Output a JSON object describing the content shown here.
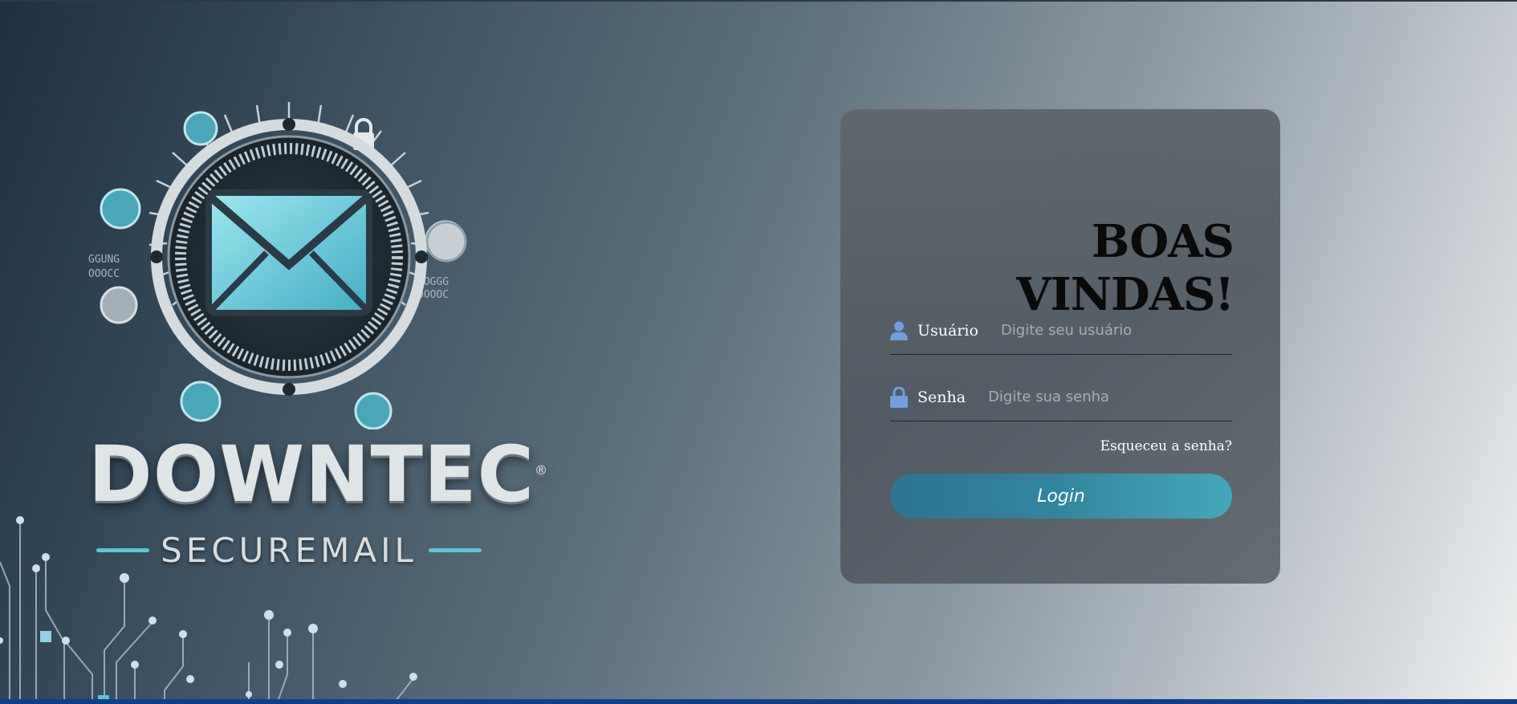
{
  "brand": {
    "name": "DOWNTEC",
    "trademark": "®",
    "subtitle": "SECUREMAIL"
  },
  "login": {
    "title": "BOAS VINDAS!",
    "username": {
      "label": "Usuário",
      "placeholder": "Digite seu usuário",
      "icon": "user-icon"
    },
    "password": {
      "label": "Senha",
      "placeholder": "Digite sua senha",
      "icon": "lock-icon"
    },
    "forgot_link": "Esqueceu a senha?",
    "submit_label": "Login"
  },
  "colors": {
    "accent": "#5fc3d6",
    "icon_blue": "#6f9fdd",
    "button_start": "#2c7592",
    "button_end": "#44a8b8"
  }
}
